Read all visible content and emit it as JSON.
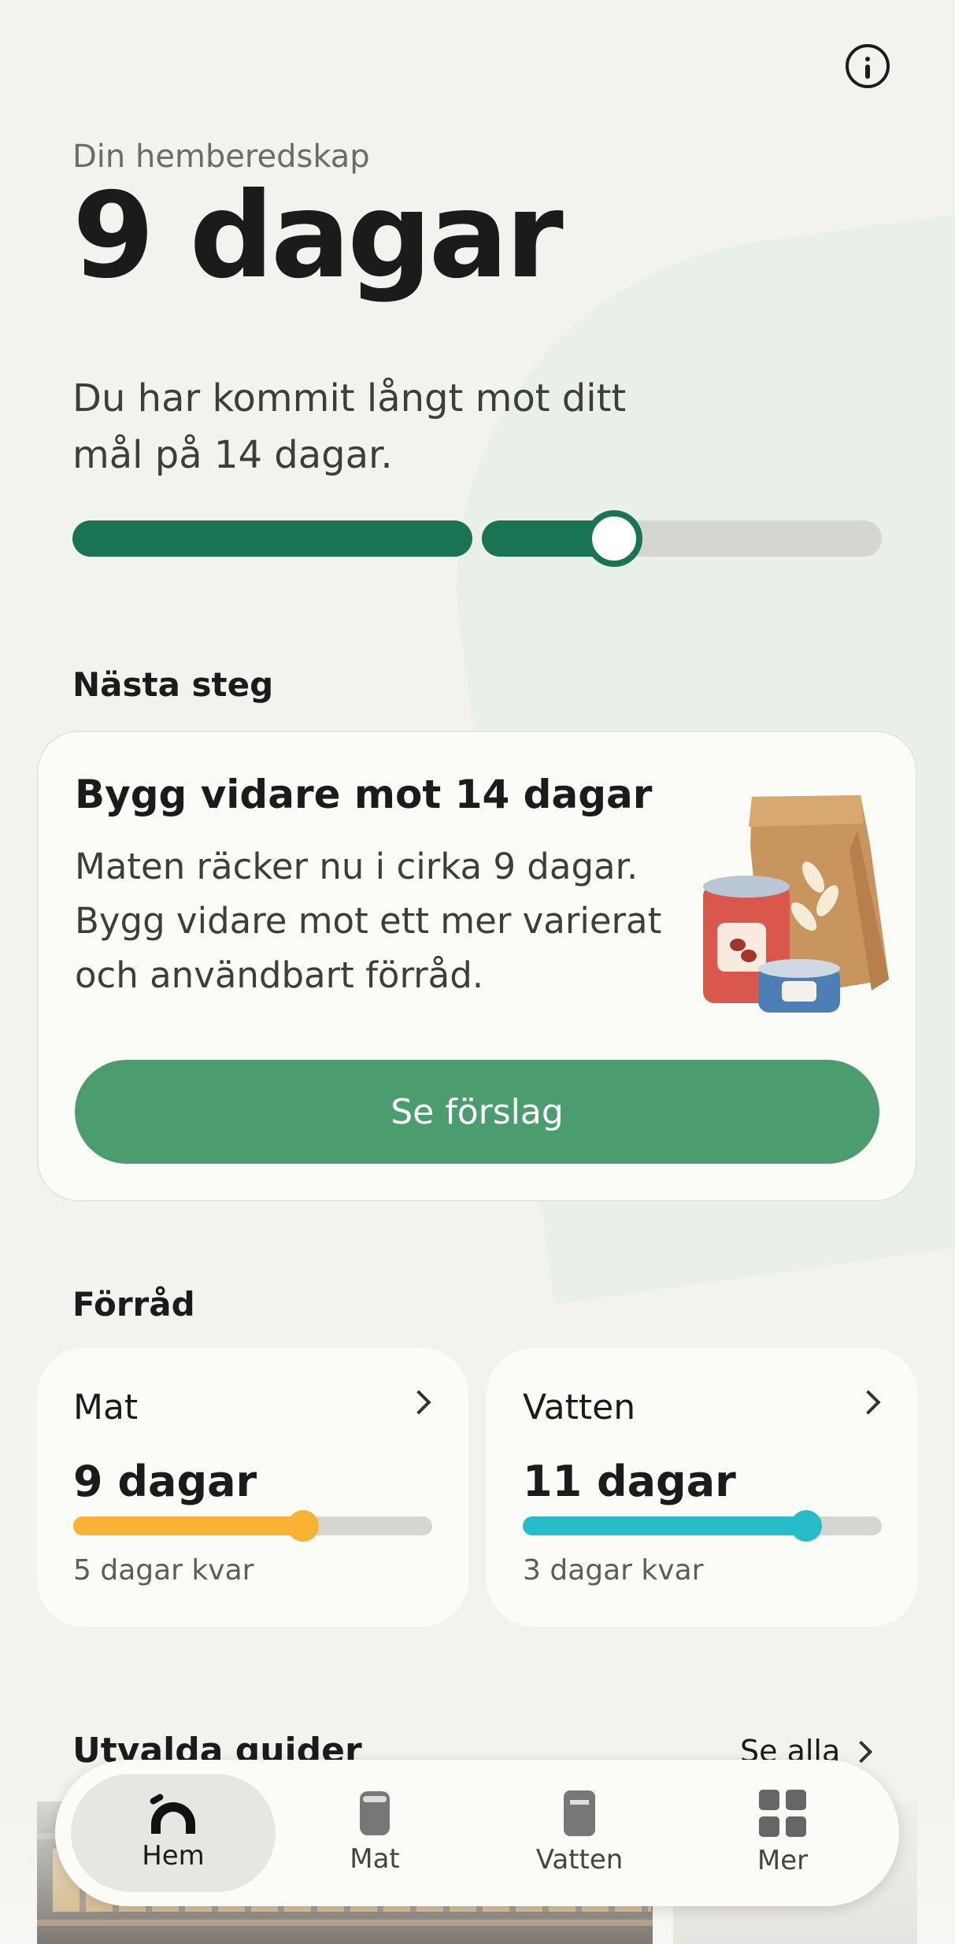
{
  "header": {
    "info_icon": "info-icon",
    "eyebrow": "Din hemberedskap",
    "headline": "9 dagar",
    "subtitle": "Du har kommit långt mot ditt mål på 14 dagar.",
    "progress": {
      "current_days": 9,
      "goal_days": 14,
      "fraction": 0.643
    }
  },
  "next_step": {
    "section_title": "Nästa steg",
    "title": "Bygg vidare mot 14 dagar",
    "body": "Maten räcker nu i cirka 9 dagar. Bygg vidare mot ett mer varierat och användbart förråd.",
    "illustration": "food-supplies-illustration",
    "button_label": "Se förslag"
  },
  "stock": {
    "section_title": "Förråd",
    "items": [
      {
        "name": "Mat",
        "days": "9 dagar",
        "remaining": "5 dagar kvar",
        "fraction": 0.64,
        "color": "#f9b233"
      },
      {
        "name": "Vatten",
        "days": "11 dagar",
        "remaining": "3 dagar kvar",
        "fraction": 0.79,
        "color": "#26bcc8"
      }
    ]
  },
  "guides": {
    "section_title": "Utvalda guider",
    "see_all": "Se alla"
  },
  "nav": {
    "items": [
      {
        "label": "Hem",
        "icon": "home-icon",
        "active": true
      },
      {
        "label": "Mat",
        "icon": "can-icon",
        "active": false
      },
      {
        "label": "Vatten",
        "icon": "water-jug-icon",
        "active": false
      },
      {
        "label": "Mer",
        "icon": "grid-icon",
        "active": false
      }
    ]
  },
  "colors": {
    "accent": "#1a7453",
    "button": "#4b9d6f",
    "background": "#f2f2ee"
  }
}
